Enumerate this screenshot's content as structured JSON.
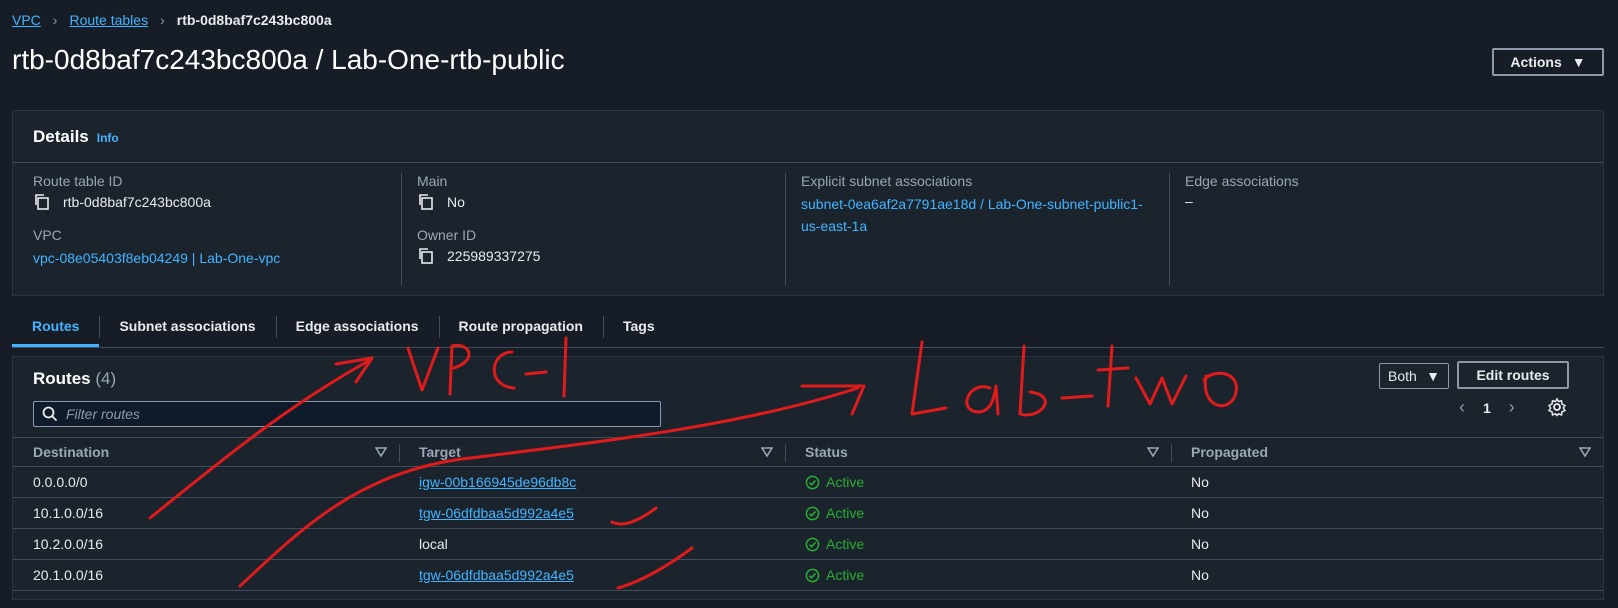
{
  "breadcrumb": {
    "items": [
      {
        "label": "VPC"
      },
      {
        "label": "Route tables"
      }
    ],
    "current": "rtb-0d8baf7c243bc800a"
  },
  "page": {
    "title": "rtb-0d8baf7c243bc800a / Lab-One-rtb-public",
    "actions_label": "Actions"
  },
  "details": {
    "heading": "Details",
    "info": "Info",
    "route_table_id_label": "Route table ID",
    "route_table_id": "rtb-0d8baf7c243bc800a",
    "vpc_label": "VPC",
    "vpc": "vpc-08e05403f8eb04249 | Lab-One-vpc",
    "main_label": "Main",
    "main": "No",
    "owner_label": "Owner ID",
    "owner": "225989337275",
    "explicit_label": "Explicit subnet associations",
    "explicit_line1": "subnet-0ea6af2a7791ae18d / Lab-One-subnet-public1-",
    "explicit_line2": "us-east-1a",
    "edge_label": "Edge associations",
    "edge": "–"
  },
  "tabs": [
    {
      "label": "Routes"
    },
    {
      "label": "Subnet associations"
    },
    {
      "label": "Edge associations"
    },
    {
      "label": "Route propagation"
    },
    {
      "label": "Tags"
    }
  ],
  "routes": {
    "title": "Routes",
    "count": "(4)",
    "filter_placeholder": "Filter routes",
    "both_label": "Both",
    "edit_label": "Edit routes",
    "page_number": "1",
    "columns": [
      "Destination",
      "Target",
      "Status",
      "Propagated"
    ],
    "rows": [
      {
        "destination": "0.0.0.0/0",
        "target": "igw-00b166945de96db8c",
        "target_link": true,
        "status": "Active",
        "propagated": "No"
      },
      {
        "destination": "10.1.0.0/16",
        "target": "tgw-06dfdbaa5d992a4e5",
        "target_link": true,
        "status": "Active",
        "propagated": "No"
      },
      {
        "destination": "10.2.0.0/16",
        "target": "local",
        "target_link": false,
        "status": "Active",
        "propagated": "No"
      },
      {
        "destination": "20.1.0.0/16",
        "target": "tgw-06dfdbaa5d992a4e5",
        "target_link": true,
        "status": "Active",
        "propagated": "No"
      }
    ]
  },
  "colors": {
    "background": "#161d26",
    "panel": "#1b232d",
    "link": "#42b4ff",
    "active_status": "#29ad32",
    "annotation_ink": "#e01b1b"
  },
  "annotation": {
    "description": "Red handwritten ink overlay",
    "text1": "VPC-1",
    "text2": "Lab-two"
  }
}
